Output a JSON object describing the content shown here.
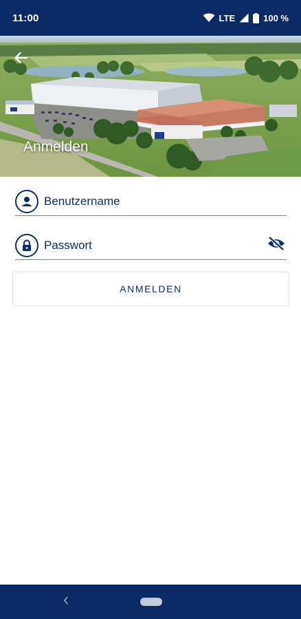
{
  "status_bar": {
    "time": "11:00",
    "network": "LTE",
    "battery": "100 %"
  },
  "header": {
    "title": "Anmelden",
    "back_icon": "arrow-back-icon"
  },
  "form": {
    "username": {
      "placeholder": "Benutzername",
      "value": "",
      "icon": "person-icon"
    },
    "password": {
      "placeholder": "Passwort",
      "value": "",
      "icon": "lock-icon",
      "toggle_icon": "eye-off-icon"
    },
    "submit_label": "ANMELDEN"
  },
  "colors": {
    "primary": "#0d2c6e",
    "bars": "#0a2a66",
    "background": "#ffffff"
  }
}
